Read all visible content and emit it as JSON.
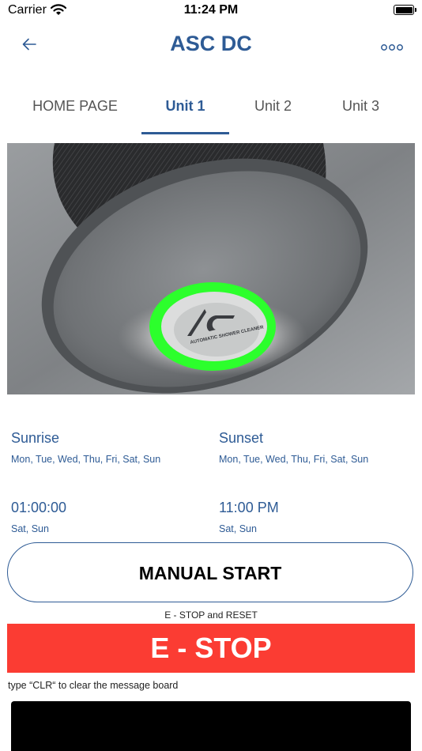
{
  "status_bar": {
    "carrier": "Carrier",
    "time": "11:24 PM",
    "icons": [
      "wifi-icon",
      "battery-icon"
    ]
  },
  "nav": {
    "title": "ASC DC",
    "back_icon": "back-arrow-icon",
    "more_icon": "more-icon"
  },
  "tabs": [
    {
      "label": "HOME PAGE",
      "active": false
    },
    {
      "label": "Unit 1",
      "active": true
    },
    {
      "label": "Unit 2",
      "active": false
    },
    {
      "label": "Unit 3",
      "active": false
    }
  ],
  "hero": {
    "logo_letters": "AC",
    "logo_text": "AUTOMATIC SHOWER CLEANER"
  },
  "schedule": {
    "sunrise": {
      "title": "Sunrise",
      "days": "Mon, Tue, Wed, Thu, Fri, Sat, Sun"
    },
    "sunset": {
      "title": "Sunset",
      "days": "Mon, Tue, Wed, Thu, Fri, Sat, Sun"
    },
    "timer1": {
      "time": "01:00:00",
      "days": "Sat, Sun"
    },
    "timer2": {
      "time": "11:00 PM",
      "days": "Sat, Sun"
    }
  },
  "controls": {
    "manual_start": "MANUAL START",
    "estop_caption": "E - STOP and RESET",
    "estop_label": "E - STOP",
    "clr_hint": "type   “CLR“ to clear the message board"
  },
  "colors": {
    "accent": "#2e5b95",
    "estop": "#fb3c33",
    "ring_green": "#2cff2c"
  }
}
